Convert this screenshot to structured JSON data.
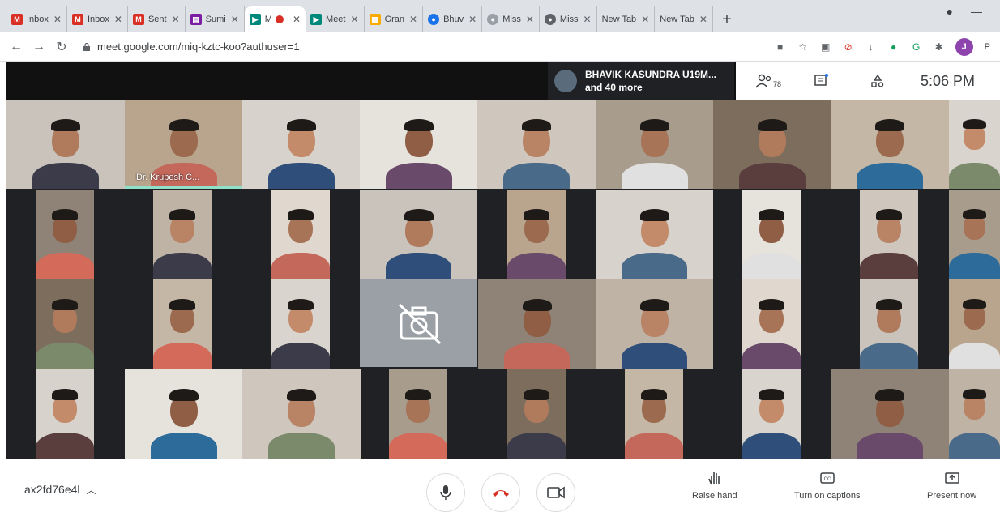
{
  "browser": {
    "tabs": [
      {
        "label": "Inbox",
        "favicon": "gmail-icon",
        "color": "#d93025"
      },
      {
        "label": "Inbox",
        "favicon": "gmail-icon",
        "color": "#d93025"
      },
      {
        "label": "Sent",
        "favicon": "gmail-icon",
        "color": "#d93025"
      },
      {
        "label": "Sumi",
        "favicon": "forms-icon",
        "color": "#7b1fa2"
      },
      {
        "label": "M",
        "favicon": "meet-icon",
        "color": "#00897b",
        "active": true
      },
      {
        "label": "Meet",
        "favicon": "meet-icon",
        "color": "#00897b"
      },
      {
        "label": "Gran",
        "favicon": "sheets-icon",
        "color": "#f9ab00"
      },
      {
        "label": "Bhuv",
        "favicon": "globe-icon",
        "color": "#1a73e8"
      },
      {
        "label": "Miss",
        "favicon": "globe-icon",
        "color": "#9aa0a6"
      },
      {
        "label": "Miss",
        "favicon": "globe-icon",
        "color": "#5f6368"
      },
      {
        "label": "New Tab",
        "favicon": "",
        "color": ""
      },
      {
        "label": "New Tab",
        "favicon": "",
        "color": ""
      }
    ],
    "url": "meet.google.com/miq-kztc-koo?authuser=1",
    "profile_initial": "J",
    "profile_text": "P"
  },
  "meet": {
    "presenter_line1": "BHAVIK KASUNDRA U19M...",
    "presenter_line2": "and 40 more",
    "participants_count": "78",
    "clock": "5:06 PM",
    "speaker_name": "Dr. Krupesh C...",
    "meeting_code": "ax2fd76e4l",
    "actions": {
      "raise_hand": "Raise hand",
      "captions": "Turn on captions",
      "present": "Present now"
    }
  },
  "colors": {
    "end_call": "#d93025",
    "speaking": "#8ee0c9",
    "grid_bg": "#202124"
  }
}
